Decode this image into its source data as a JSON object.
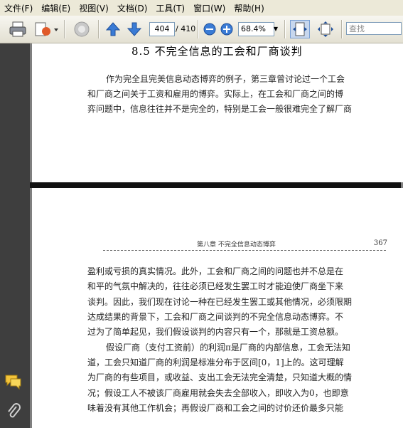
{
  "menu": [
    "文件(F)",
    "编辑(E)",
    "视图(V)",
    "文档(D)",
    "工具(T)",
    "窗口(W)",
    "帮助(H)"
  ],
  "toolbar": {
    "page_current": "404",
    "page_total": "/ 410",
    "zoom": "68.4%",
    "search_placeholder": "查找"
  },
  "page_top": {
    "heading": "8.5  不完全信息的工会和厂商谈判",
    "lines": [
      "作为完全且完美信息动态博弈的例子，第三章曾讨论过一个工会",
      "和厂商之间关于工资和雇用的博弈。实际上，在工会和厂商之间的博",
      "弈问题中，信息往往并不是完全的，特别是工会一般很难完全了解厂商"
    ]
  },
  "page_bottom": {
    "running_head": "第八章   不完全信息动态博弈",
    "page_number": "367",
    "lines": [
      "盈利或亏损的真实情况。此外，工会和厂商之间的问题也并不总是在",
      "和平的气氛中解决的，往往必须已经发生罢工时才能迫使厂商坐下来",
      "谈判。因此，我们现在讨论一种在已经发生罢工或其他情况，必须限期",
      "达成结果的背景下，工会和厂商之间谈判的不完全信息动态博弈。不",
      "过为了简单起见，我们假设谈判的内容只有一个，那就是工资总额。",
      "假设厂商（支付工资前）的利润π是厂商的内部信息，工会无法知",
      "道，工会只知道厂商的利润是标准分布于区间[0，1]上的。这可理解",
      "为厂商的有些项目，或收益、支出工会无法完全清楚，只知道大概的情",
      "况；假设工人不被该厂商雇用就会失去全部收入，即收入为0，也即意",
      "味着没有其他工作机会；再假设厂商和工会之间的讨价还价最多只能"
    ]
  }
}
